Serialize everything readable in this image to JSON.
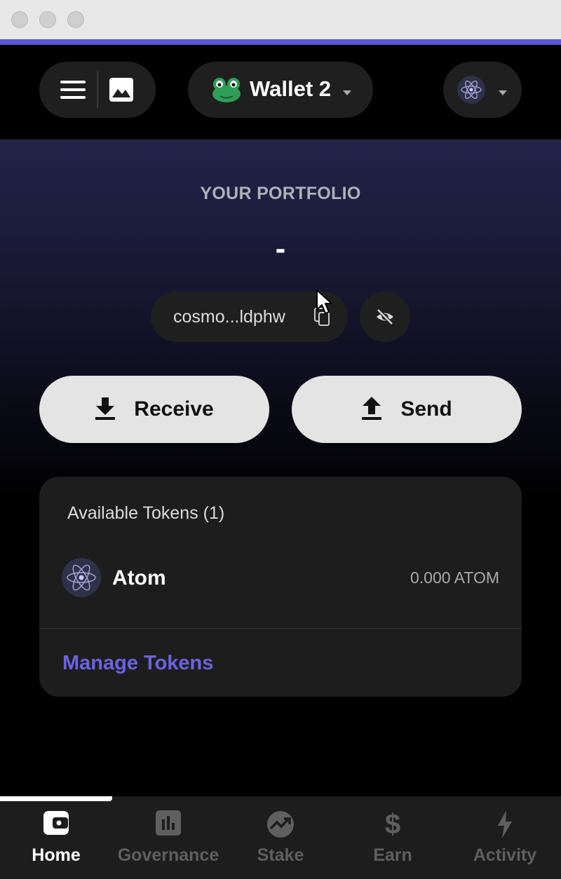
{
  "header": {
    "wallet_name": "Wallet 2"
  },
  "portfolio": {
    "label": "YOUR PORTFOLIO",
    "value": "-"
  },
  "address": {
    "short": "cosmo...ldphw"
  },
  "actions": {
    "receive_label": "Receive",
    "send_label": "Send"
  },
  "tokens": {
    "header": "Available Tokens (1)",
    "items": [
      {
        "name": "Atom",
        "balance": "0.000 ATOM"
      }
    ],
    "manage_label": "Manage Tokens"
  },
  "nav": {
    "items": [
      {
        "label": "Home",
        "icon": "wallet-icon",
        "active": true
      },
      {
        "label": "Governance",
        "icon": "chart-icon",
        "active": false
      },
      {
        "label": "Stake",
        "icon": "trending-icon",
        "active": false
      },
      {
        "label": "Earn",
        "icon": "dollar-icon",
        "active": false
      },
      {
        "label": "Activity",
        "icon": "lightning-icon",
        "active": false
      }
    ]
  },
  "colors": {
    "accent": "#5e57d6",
    "link": "#6b63e0",
    "active_nav": "#ffffff",
    "inactive_nav": "#5f5f5f"
  }
}
